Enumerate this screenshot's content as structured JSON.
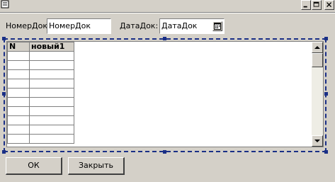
{
  "window": {
    "icons": {
      "system": "document-window-icon",
      "minimize": "minimize-icon",
      "maximize": "maximize-icon",
      "close": "close-icon"
    }
  },
  "form": {
    "doc_number": {
      "label": "НомерДок:",
      "value": "НомерДок"
    },
    "doc_date": {
      "label": "ДатаДок:",
      "value": "ДатаДок",
      "picker_icon": "calendar-icon"
    }
  },
  "grid": {
    "columns": [
      "N",
      "новый1"
    ],
    "rows": [
      [
        "",
        ""
      ],
      [
        "",
        ""
      ],
      [
        "",
        ""
      ],
      [
        "",
        ""
      ],
      [
        "",
        ""
      ],
      [
        "",
        ""
      ],
      [
        "",
        ""
      ],
      [
        "",
        ""
      ],
      [
        "",
        ""
      ],
      [
        "",
        ""
      ]
    ]
  },
  "buttons": {
    "ok": "ОК",
    "close": "Закрыть"
  }
}
